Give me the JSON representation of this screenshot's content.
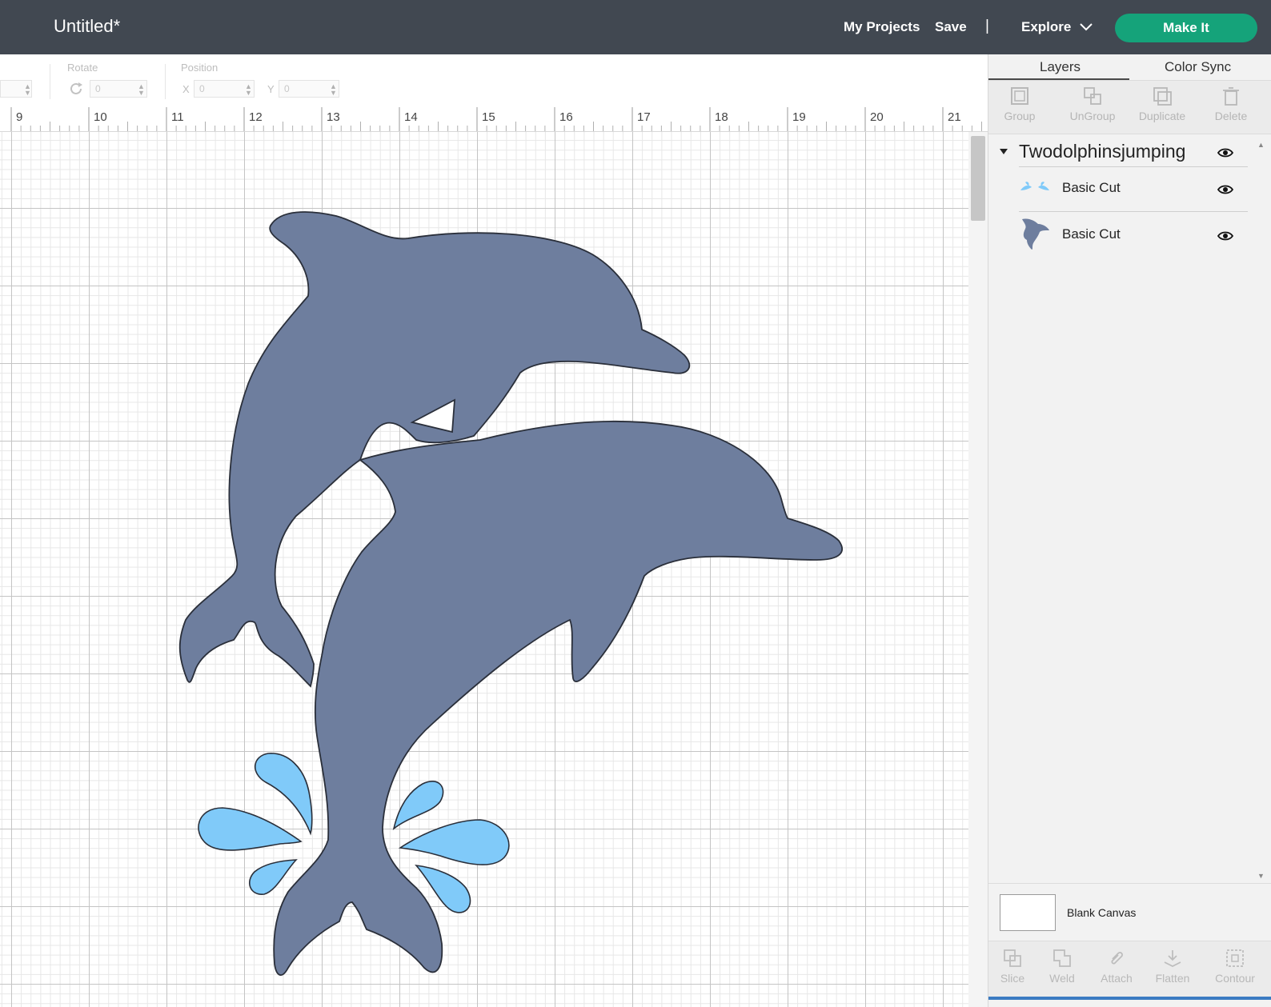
{
  "header": {
    "title": "Untitled*",
    "my_projects": "My Projects",
    "save": "Save",
    "separator": "|",
    "explore": "Explore",
    "make_it": "Make It",
    "accent_color": "#15a37a",
    "bar_color": "#414851"
  },
  "toolbar": {
    "rotate_label": "Rotate",
    "rotate_value": "0",
    "position_label": "Position",
    "x_label": "X",
    "x_value": "0",
    "y_label": "Y",
    "y_value": "0"
  },
  "ruler": {
    "ticks": [
      "9",
      "10",
      "11",
      "12",
      "13",
      "14",
      "15",
      "16",
      "17",
      "18",
      "19",
      "20",
      "21"
    ]
  },
  "canvas": {
    "dolphin_color": "#6e7e9e",
    "splash_color": "#80caf9"
  },
  "panel": {
    "tabs": [
      "Layers",
      "Color Sync"
    ],
    "active_tab": "Layers",
    "tools": [
      "Group",
      "UnGroup",
      "Duplicate",
      "Delete"
    ],
    "group_name": "Twodolphinsjumping",
    "layers": [
      {
        "name": "Basic Cut",
        "icon": "splash-icon"
      },
      {
        "name": "Basic Cut",
        "icon": "dolphin-icon"
      }
    ],
    "blank_canvas": "Blank Canvas",
    "bottom_tools": [
      "Slice",
      "Weld",
      "Attach",
      "Flatten",
      "Contour"
    ]
  }
}
